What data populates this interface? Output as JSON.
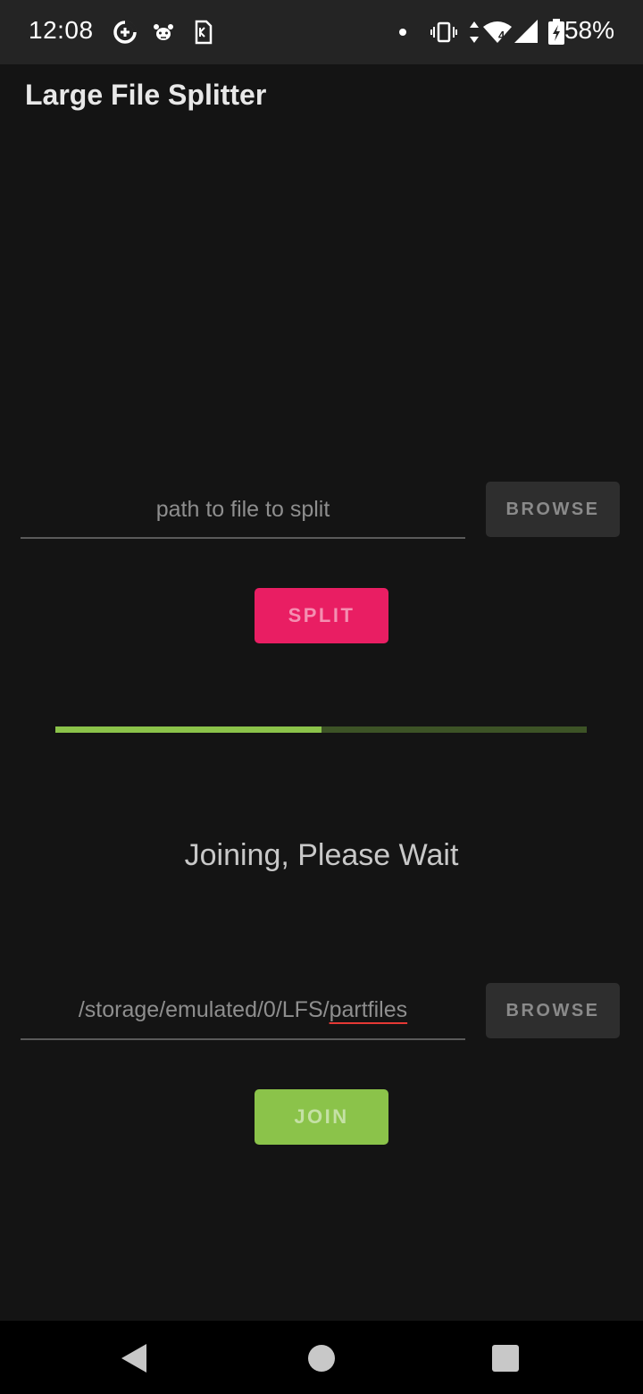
{
  "status_bar": {
    "time": "12:08",
    "battery_percent": "58%",
    "network_label": "4",
    "notification_icons": [
      "data-saver-icon",
      "paw-app-icon",
      "sim-card-icon"
    ],
    "system_icons": [
      "notification-dot-icon",
      "vibrate-icon",
      "data-arrows-icon",
      "wifi-icon",
      "cell-signal-icon",
      "battery-charging-icon"
    ]
  },
  "app": {
    "title": "Large File Splitter"
  },
  "split_section": {
    "input_placeholder": "path to file to split",
    "input_value": "",
    "browse_label": "BROWSE",
    "split_label": "SPLIT"
  },
  "progress": {
    "value": 0.5,
    "status_message": "Joining, Please Wait"
  },
  "join_section": {
    "path_prefix": "/storage/emulated/0/LFS/",
    "path_misspelled": "partfiles",
    "browse_label": "BROWSE",
    "join_label": "JOIN"
  },
  "nav_bar": {
    "icons": [
      "back-icon",
      "home-icon",
      "recents-icon"
    ]
  },
  "colors": {
    "background": "#141414",
    "accent_pink": "#e91e63",
    "accent_green": "#8bc34a",
    "progress_track": "#3d5326"
  }
}
